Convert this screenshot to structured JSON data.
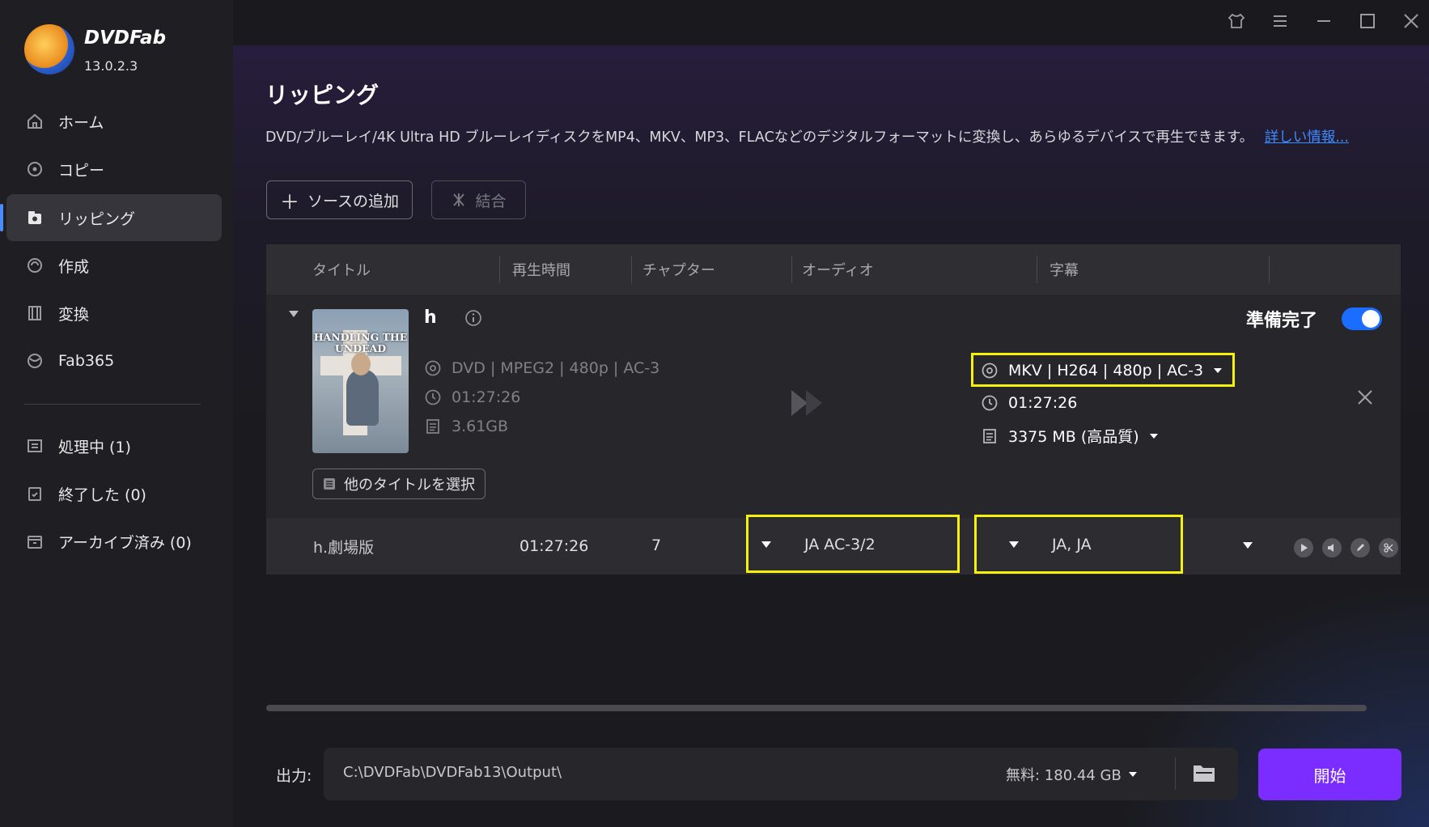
{
  "app": {
    "name": "DVDFab",
    "version": "13.0.2.3"
  },
  "sidebar": {
    "items": [
      {
        "label": "ホーム"
      },
      {
        "label": "コピー"
      },
      {
        "label": "リッピング"
      },
      {
        "label": "作成"
      },
      {
        "label": "変換"
      },
      {
        "label": "Fab365"
      }
    ],
    "queue": [
      {
        "label": "処理中 (1)"
      },
      {
        "label": "終了した (0)"
      },
      {
        "label": "アーカイブ済み (0)"
      }
    ]
  },
  "page": {
    "title": "リッピング",
    "description": "DVD/ブルーレイ/4K Ultra HD ブルーレイディスクをMP4、MKV、MP3、FLACなどのデジタルフォーマットに変換し、あらゆるデバイスで再生できます。",
    "more_link": "詳しい情報..."
  },
  "toolbar": {
    "add_source": "ソースの追加",
    "merge": "結合"
  },
  "table": {
    "headers": [
      "タイトル",
      "再生時間",
      "チャプター",
      "オーディオ",
      "字幕"
    ]
  },
  "item": {
    "title": "h",
    "poster_text": "HANDLING THE UNDEAD",
    "ready_label": "準備完了",
    "ready_on": true,
    "source": {
      "format": "DVD | MPEG2 | 480p | AC-3",
      "duration": "01:27:26",
      "size": "3.61GB"
    },
    "output": {
      "profile": "MKV | H264 | 480p | AC-3",
      "duration": "01:27:26",
      "size": "3375 MB (高品質)"
    },
    "select_other": "他のタイトルを選択"
  },
  "row": {
    "name": "h.劇場版",
    "duration": "01:27:26",
    "chapters": "7",
    "audio": "JA  AC-3/2",
    "subtitle": "JA, JA"
  },
  "footer": {
    "output_label": "出力:",
    "path": "C:\\DVDFab\\DVDFab13\\Output\\",
    "free_space": "無料: 180.44 GB",
    "start": "開始"
  },
  "colors": {
    "accent": "#4a8cff",
    "toggle": "#1a6dff",
    "start": "#7b2dff",
    "highlight": "#f5f10a"
  }
}
